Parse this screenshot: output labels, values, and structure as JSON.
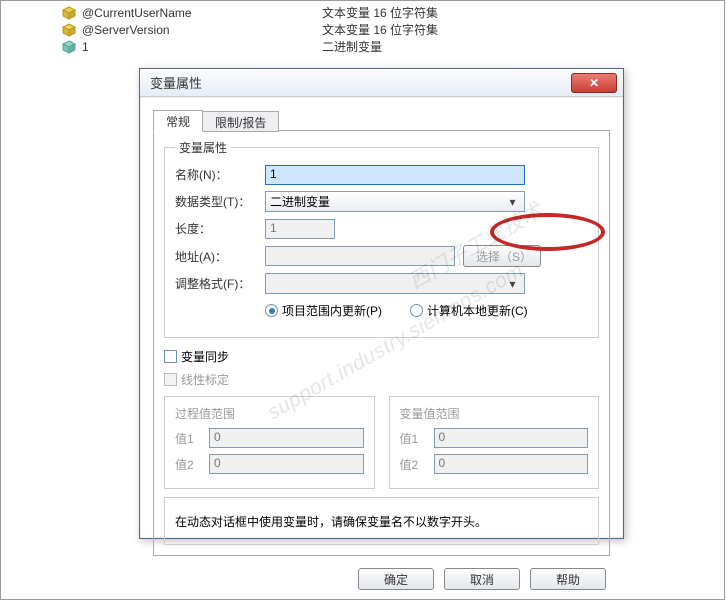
{
  "bglist": {
    "rows": [
      {
        "name": "@CurrentUserName",
        "desc": "文本变量 16 位字符集"
      },
      {
        "name": "@ServerVersion",
        "desc": "文本变量 16 位字符集"
      },
      {
        "name": "1",
        "desc": "二进制变量"
      }
    ]
  },
  "dialog": {
    "title": "变量属性",
    "tabs": {
      "general": "常规",
      "limit": "限制/报告"
    },
    "props": {
      "group": "变量属性",
      "name_label": "名称(N)：",
      "name_value": "1",
      "datatype_label": "数据类型(T)：",
      "datatype_value": "二进制变量",
      "length_label": "长度：",
      "length_value": "1",
      "addr_label": "地址(A)：",
      "addr_value": "",
      "select_btn": "选择（S）",
      "format_label": "调整格式(F)：",
      "format_value": "",
      "radio_project": "项目范围内更新(P)",
      "radio_computer": "计算机本地更新(C)"
    },
    "sync": {
      "chk": "变量同步",
      "chk2": "线性标定"
    },
    "ranges": {
      "proc": "过程值范围",
      "var": "变量值范围",
      "v1": "值1",
      "v2": "值2",
      "pv1": "0",
      "pv2": "0",
      "vv1": "0",
      "vv2": "0"
    },
    "note": "在动态对话框中使用变量时，请确保变量名不以数字开头。",
    "buttons": {
      "ok": "确定",
      "cancel": "取消",
      "help": "帮助"
    }
  },
  "watermark": "support.industry.siemens.com"
}
